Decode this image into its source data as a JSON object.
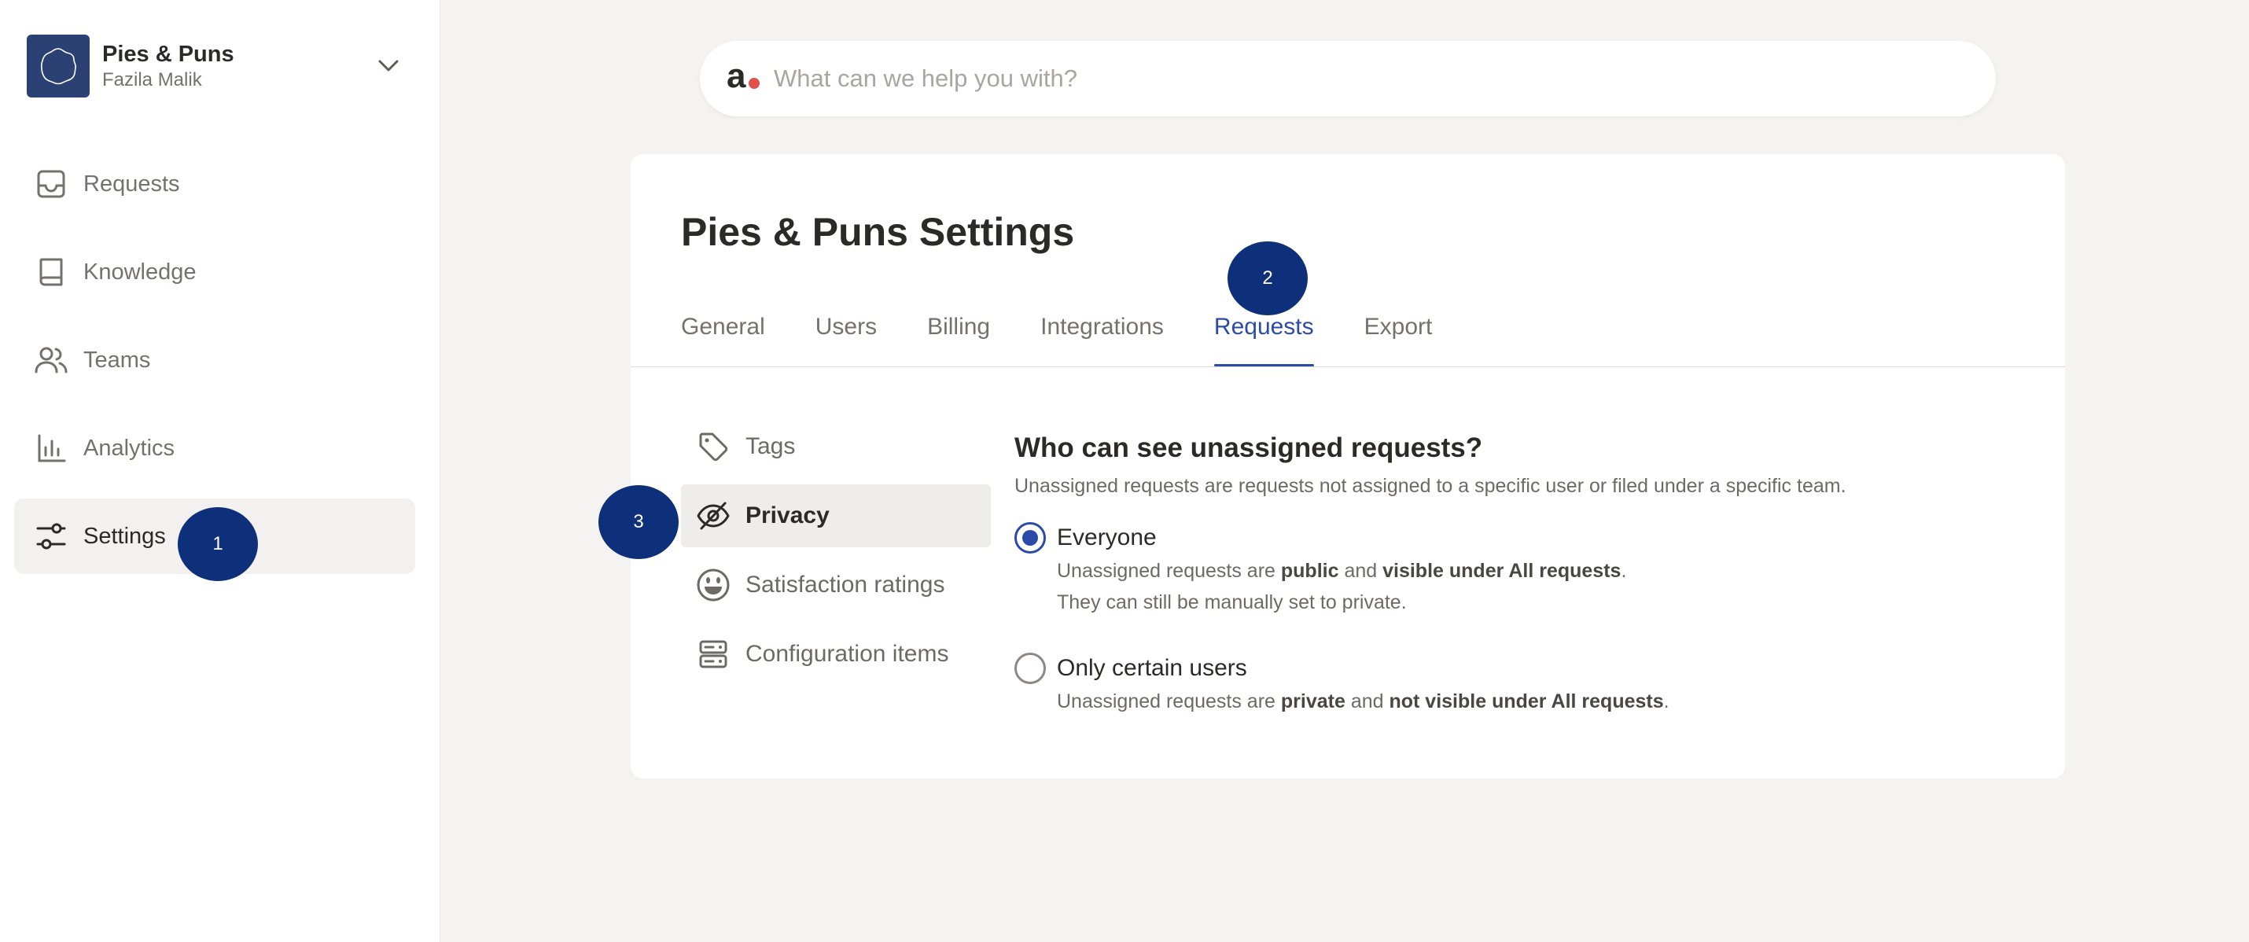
{
  "org": {
    "name": "Pies & Puns",
    "user": "Fazila Malik"
  },
  "sidebar": {
    "items": [
      {
        "label": "Requests",
        "icon": "inbox-icon"
      },
      {
        "label": "Knowledge",
        "icon": "book-icon"
      },
      {
        "label": "Teams",
        "icon": "users-icon"
      },
      {
        "label": "Analytics",
        "icon": "bar-chart-icon"
      },
      {
        "label": "Settings",
        "icon": "sliders-icon",
        "active": true
      }
    ]
  },
  "search": {
    "placeholder": "What can we help you with?",
    "logo": "a"
  },
  "settings": {
    "title_org": "Pies & Puns",
    "title_suffix": "Settings",
    "tabs": [
      "General",
      "Users",
      "Billing",
      "Integrations",
      "Requests",
      "Export"
    ],
    "active_tab": "Requests",
    "subnav": [
      {
        "label": "Tags",
        "icon": "tag-icon"
      },
      {
        "label": "Privacy",
        "icon": "eye-off-icon",
        "active": true
      },
      {
        "label": "Satisfaction ratings",
        "icon": "smiley-icon"
      },
      {
        "label": "Configuration items",
        "icon": "server-icon"
      }
    ]
  },
  "privacy": {
    "question": "Who can see unassigned requests?",
    "description": "Unassigned requests are requests not assigned to a specific user or filed under a specific team.",
    "options": [
      {
        "label": "Everyone",
        "checked": true,
        "desc_prefix": "Unassigned requests are ",
        "desc_b1": "public",
        "desc_mid": " and ",
        "desc_b2": "visible under All requests",
        "desc_end": ".",
        "desc_line2": "They can still be manually set to private."
      },
      {
        "label": "Only certain users",
        "checked": false,
        "desc_prefix": "Unassigned requests are ",
        "desc_b1": "private",
        "desc_mid": " and ",
        "desc_b2": "not visible under All requests",
        "desc_end": "."
      }
    ]
  },
  "markers": [
    "1",
    "2",
    "3"
  ],
  "colors": {
    "accent": "#2c4ba8",
    "marker": "#0e2f7a",
    "org_logo": "#2c4173",
    "search_dot": "#e0514c",
    "background": "#f4f3f1"
  }
}
